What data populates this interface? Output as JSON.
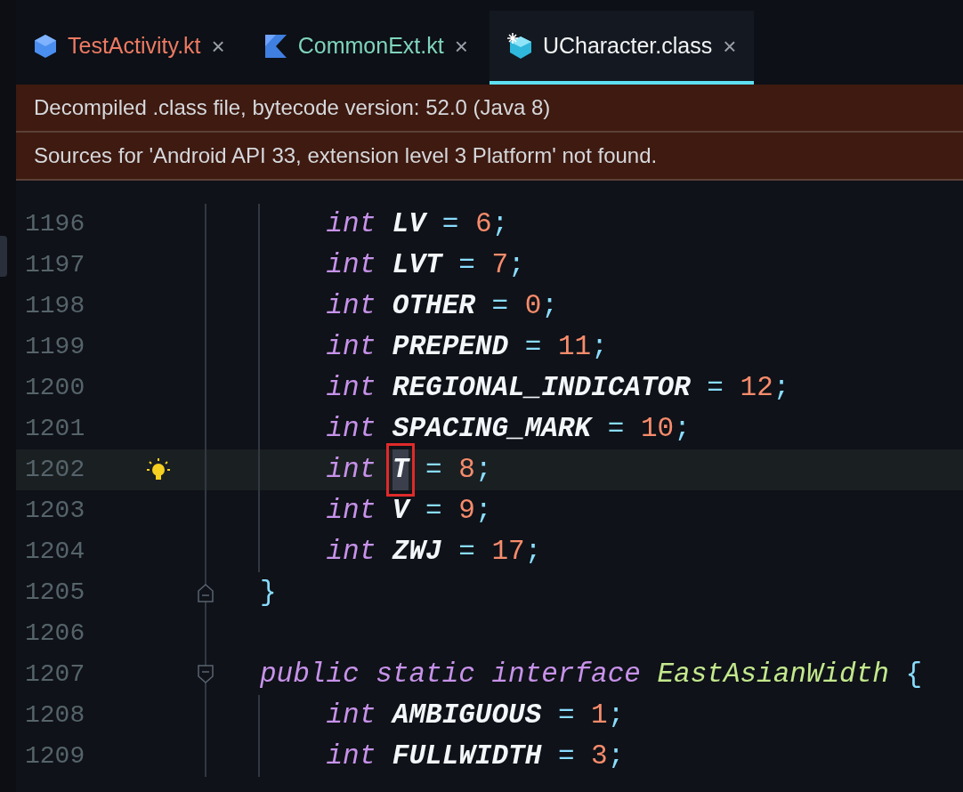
{
  "tabs": [
    {
      "label": "TestActivity.kt",
      "color": "#ec7a63",
      "selected": false,
      "close": "×"
    },
    {
      "label": "CommonExt.kt",
      "color": "#7fd4bd",
      "selected": false,
      "close": "×"
    },
    {
      "label": "UCharacter.class",
      "color": "#f2f4f5",
      "selected": true,
      "close": "×"
    }
  ],
  "banners": [
    "Decompiled .class file, bytecode version: 52.0 (Java 8)",
    "Sources for 'Android API 33, extension level 3 Platform' not found."
  ],
  "lines": [
    {
      "number": "1196",
      "kind": "field",
      "current": false,
      "bulb": false,
      "fold_start": false,
      "fold_end": false,
      "indent_guide": true,
      "type": "int",
      "name": "LV",
      "op": "=",
      "value": "6",
      "end": ";",
      "selected": false
    },
    {
      "number": "1197",
      "kind": "field",
      "current": false,
      "bulb": false,
      "fold_start": false,
      "fold_end": false,
      "indent_guide": true,
      "type": "int",
      "name": "LVT",
      "op": "=",
      "value": "7",
      "end": ";",
      "selected": false
    },
    {
      "number": "1198",
      "kind": "field",
      "current": false,
      "bulb": false,
      "fold_start": false,
      "fold_end": false,
      "indent_guide": true,
      "type": "int",
      "name": "OTHER",
      "op": "=",
      "value": "0",
      "end": ";",
      "selected": false
    },
    {
      "number": "1199",
      "kind": "field",
      "current": false,
      "bulb": false,
      "fold_start": false,
      "fold_end": false,
      "indent_guide": true,
      "type": "int",
      "name": "PREPEND",
      "op": "=",
      "value": "11",
      "end": ";",
      "selected": false
    },
    {
      "number": "1200",
      "kind": "field",
      "current": false,
      "bulb": false,
      "fold_start": false,
      "fold_end": false,
      "indent_guide": true,
      "type": "int",
      "name": "REGIONAL_INDICATOR",
      "op": "=",
      "value": "12",
      "end": ";",
      "selected": false
    },
    {
      "number": "1201",
      "kind": "field",
      "current": false,
      "bulb": false,
      "fold_start": false,
      "fold_end": false,
      "indent_guide": true,
      "type": "int",
      "name": "SPACING_MARK",
      "op": "=",
      "value": "10",
      "end": ";",
      "selected": false
    },
    {
      "number": "1202",
      "kind": "field",
      "current": true,
      "bulb": true,
      "fold_start": false,
      "fold_end": false,
      "indent_guide": true,
      "type": "int",
      "name": "T",
      "op": "=",
      "value": "8",
      "end": ";",
      "selected": true
    },
    {
      "number": "1203",
      "kind": "field",
      "current": false,
      "bulb": false,
      "fold_start": false,
      "fold_end": false,
      "indent_guide": true,
      "type": "int",
      "name": "V",
      "op": "=",
      "value": "9",
      "end": ";",
      "selected": false
    },
    {
      "number": "1204",
      "kind": "field",
      "current": false,
      "bulb": false,
      "fold_start": false,
      "fold_end": false,
      "indent_guide": true,
      "type": "int",
      "name": "ZWJ",
      "op": "=",
      "value": "17",
      "end": ";",
      "selected": false
    },
    {
      "number": "1205",
      "kind": "close",
      "current": false,
      "bulb": false,
      "fold_start": false,
      "fold_end": true,
      "indent_guide": false,
      "text": "}"
    },
    {
      "number": "1206",
      "kind": "blank",
      "current": false,
      "bulb": false,
      "fold_start": false,
      "fold_end": false,
      "indent_guide": false
    },
    {
      "number": "1207",
      "kind": "interface",
      "current": false,
      "bulb": false,
      "fold_start": true,
      "fold_end": false,
      "indent_guide": false,
      "modifiers": "public static interface",
      "name": "EastAsianWidth",
      "brace": "{"
    },
    {
      "number": "1208",
      "kind": "field",
      "current": false,
      "bulb": false,
      "fold_start": false,
      "fold_end": false,
      "indent_guide": true,
      "type": "int",
      "name": "AMBIGUOUS",
      "op": "=",
      "value": "1",
      "end": ";",
      "selected": false
    },
    {
      "number": "1209",
      "kind": "field",
      "current": false,
      "bulb": false,
      "fold_start": false,
      "fold_end": false,
      "indent_guide": true,
      "type": "int",
      "name": "FULLWIDTH",
      "op": "=",
      "value": "3",
      "end": ";",
      "selected": false
    }
  ]
}
